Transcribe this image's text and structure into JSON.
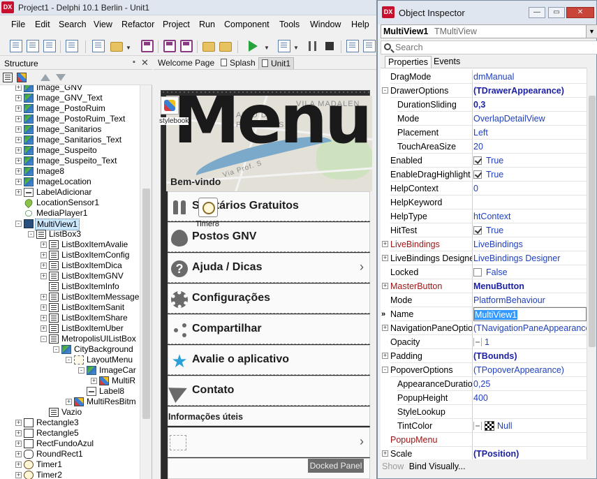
{
  "ide": {
    "title": "Project1 - Delphi 10.1 Berlin - Unit1",
    "logo": "DX",
    "menu": [
      "File",
      "Edit",
      "Search",
      "View",
      "Refactor",
      "Project",
      "Run",
      "Component",
      "Tools",
      "Window",
      "Help"
    ]
  },
  "structure": {
    "title": "Structure",
    "nodes": [
      {
        "label": "Image_GNV",
        "icon": "image-icon"
      },
      {
        "label": "Image_GNV_Text",
        "icon": "image-icon"
      },
      {
        "label": "Image_PostoRuim",
        "icon": "image-icon"
      },
      {
        "label": "Image_PostoRuim_Text",
        "icon": "image-icon"
      },
      {
        "label": "Image_Sanitarios",
        "icon": "image-icon"
      },
      {
        "label": "Image_Sanitarios_Text",
        "icon": "image-icon"
      },
      {
        "label": "Image_Suspeito",
        "icon": "image-icon"
      },
      {
        "label": "Image_Suspeito_Text",
        "icon": "image-icon"
      },
      {
        "label": "Image8",
        "icon": "image-icon"
      },
      {
        "label": "ImageLocation",
        "icon": "image-icon"
      },
      {
        "label": "LabelAdicionar",
        "icon": "label-icon"
      },
      {
        "label": "LocationSensor1",
        "icon": "location-icon"
      },
      {
        "label": "MediaPlayer1",
        "icon": "media-icon"
      },
      {
        "label": "MultiView1",
        "icon": "multiview-icon"
      },
      {
        "label": "ListBox3",
        "icon": "listbox-icon"
      },
      {
        "label": "ListBoxItemAvalie",
        "icon": "listbox-icon"
      },
      {
        "label": "ListBoxItemConfig",
        "icon": "listbox-icon"
      },
      {
        "label": "ListBoxItemDica",
        "icon": "listbox-icon"
      },
      {
        "label": "ListBoxItemGNV",
        "icon": "listbox-icon"
      },
      {
        "label": "ListBoxItemInfo",
        "icon": "listbox-icon"
      },
      {
        "label": "ListBoxItemMessage",
        "icon": "listbox-icon"
      },
      {
        "label": "ListBoxItemSanit",
        "icon": "listbox-icon"
      },
      {
        "label": "ListBoxItemShare",
        "icon": "listbox-icon"
      },
      {
        "label": "ListBoxItemUber",
        "icon": "listbox-icon"
      },
      {
        "label": "MetropolisUIListBox",
        "icon": "listbox-icon"
      },
      {
        "label": "CityBackground",
        "icon": "image-icon"
      },
      {
        "label": "LayoutMenu",
        "icon": "layout-icon"
      },
      {
        "label": "ImageCar",
        "icon": "image-icon"
      },
      {
        "label": "MultiR",
        "icon": "multires-icon"
      },
      {
        "label": "Label8",
        "icon": "label-icon"
      },
      {
        "label": "MultiResBitm",
        "icon": "multires-icon"
      },
      {
        "label": "Vazio",
        "icon": "listbox-icon"
      },
      {
        "label": "Rectangle3",
        "icon": "rectangle-icon"
      },
      {
        "label": "Rectangle5",
        "icon": "rectangle-icon"
      },
      {
        "label": "RectFundoAzul",
        "icon": "rectangle-icon"
      },
      {
        "label": "RoundRect1",
        "icon": "roundrect-icon"
      },
      {
        "label": "Timer1",
        "icon": "timer-icon"
      },
      {
        "label": "Timer2",
        "icon": "timer-icon"
      }
    ]
  },
  "designer": {
    "tabs": [
      "Welcome Page",
      "Splash",
      "Unit1"
    ],
    "active_tab": "Unit1",
    "map_texts": [
      "VILA MADALEN",
      "ALTO DE",
      "PINHEIROS",
      "Via Prof. S"
    ],
    "menu_title": "Menu",
    "welcome": "Bem-vindo",
    "items": [
      {
        "label": "Sanitários Gratuitos",
        "icon": "toilet-icon",
        "chevron": false
      },
      {
        "label": "Postos GNV",
        "icon": "flame-icon",
        "chevron": false
      },
      {
        "label": "Ajuda / Dicas",
        "icon": "help-icon",
        "chevron": true
      },
      {
        "label": "Configurações",
        "icon": "gear-icon",
        "chevron": false
      },
      {
        "label": "Compartilhar",
        "icon": "share-icon",
        "chevron": false
      },
      {
        "label": "Avalie o aplicativo",
        "icon": "star-icon",
        "chevron": false
      },
      {
        "label": "Contato",
        "icon": "send-icon",
        "chevron": false
      }
    ],
    "info_header": "Informações úteis",
    "docked_panel": "Docked Panel",
    "timer_label": "Timer8",
    "multiview_label": "stylebook"
  },
  "inspector": {
    "title": "Object Inspector",
    "logo": "DX",
    "object_name": "MultiView1",
    "object_type": "TMultiView",
    "search_placeholder": "Search",
    "tabs": [
      "Properties",
      "Events"
    ],
    "properties": [
      {
        "name": "DragMode",
        "value": "dmManual",
        "indent": 0
      },
      {
        "name": "DrawerOptions",
        "value": "(TDrawerAppearance)",
        "indent": 0,
        "expander": "-",
        "bold": true
      },
      {
        "name": "DurationSliding",
        "value": "0,3",
        "indent": 1,
        "bold": true
      },
      {
        "name": "Mode",
        "value": "OverlapDetailView",
        "indent": 1
      },
      {
        "name": "Placement",
        "value": "Left",
        "indent": 1
      },
      {
        "name": "TouchAreaSize",
        "value": "20",
        "indent": 1
      },
      {
        "name": "Enabled",
        "value": "True",
        "indent": 0,
        "check": true
      },
      {
        "name": "EnableDragHighlight",
        "value": "True",
        "indent": 0,
        "check": true
      },
      {
        "name": "HelpContext",
        "value": "0",
        "indent": 0
      },
      {
        "name": "HelpKeyword",
        "value": "",
        "indent": 0
      },
      {
        "name": "HelpType",
        "value": "htContext",
        "indent": 0
      },
      {
        "name": "HitTest",
        "value": "True",
        "indent": 0,
        "check": true
      },
      {
        "name": "LiveBindings",
        "value": "LiveBindings",
        "indent": 0,
        "expander": "+",
        "red": true
      },
      {
        "name": "LiveBindings Designer",
        "value": "LiveBindings Designer",
        "indent": 0,
        "expander": "+"
      },
      {
        "name": "Locked",
        "value": "False",
        "indent": 0,
        "check": false
      },
      {
        "name": "MasterButton",
        "value": "MenuButton",
        "indent": 0,
        "expander": "+",
        "red": true,
        "bold": true
      },
      {
        "name": "Mode",
        "value": "PlatformBehaviour",
        "indent": 0
      },
      {
        "name": "Name",
        "value": "MultiView1",
        "indent": 0,
        "selected": true
      },
      {
        "name": "NavigationPaneOptions",
        "value": "(TNavigationPaneAppearance)",
        "indent": 0,
        "expander": "+"
      },
      {
        "name": "Opacity",
        "value": "1",
        "indent": 0,
        "opacity": true
      },
      {
        "name": "Padding",
        "value": "(TBounds)",
        "indent": 0,
        "expander": "+",
        "bold": true
      },
      {
        "name": "PopoverOptions",
        "value": "(TPopoverAppearance)",
        "indent": 0,
        "expander": "-"
      },
      {
        "name": "AppearanceDuration",
        "value": "0,25",
        "indent": 1
      },
      {
        "name": "PopupHeight",
        "value": "400",
        "indent": 1
      },
      {
        "name": "StyleLookup",
        "value": "",
        "indent": 1
      },
      {
        "name": "TintColor",
        "value": "Null",
        "indent": 1,
        "color": true
      },
      {
        "name": "PopupMenu",
        "value": "",
        "indent": 0,
        "red": true
      },
      {
        "name": "Scale",
        "value": "(TPosition)",
        "indent": 0,
        "expander": "+",
        "bold": true
      }
    ],
    "status_show": "Show",
    "status_bind": "Bind Visually..."
  }
}
